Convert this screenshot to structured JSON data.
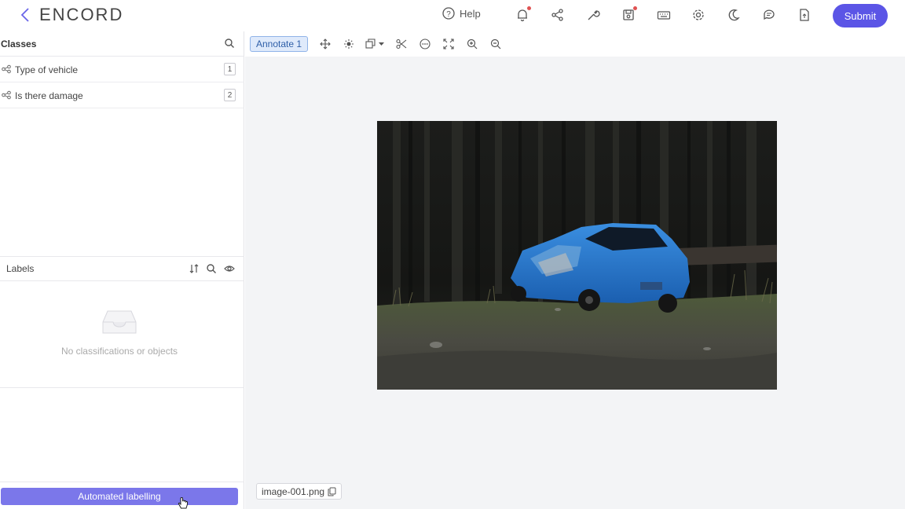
{
  "header": {
    "logo": "ENCORD",
    "help_label": "Help",
    "submit_label": "Submit",
    "accent": "#5b55e6"
  },
  "classes": {
    "title": "Classes",
    "items": [
      {
        "label": "Type of vehicle",
        "key": "1"
      },
      {
        "label": "Is there damage",
        "key": "2"
      }
    ]
  },
  "labels": {
    "title": "Labels",
    "empty_text": "No classifications or objects"
  },
  "automated_labelling_label": "Automated labelling",
  "toolbar": {
    "annotate_label": "Annotate 1"
  },
  "file": {
    "name": "image-001.png"
  },
  "icons": [
    "back-icon",
    "help-icon",
    "bell-icon",
    "share-icon",
    "wrench-icon",
    "save-icon",
    "keyboard-icon",
    "gear-icon",
    "moon-icon",
    "chat-icon",
    "document-icon",
    "search-icon",
    "sort-icon",
    "eye-icon",
    "move-icon",
    "brightness-icon",
    "shape-icon",
    "scissors-icon",
    "more-icon",
    "fit-screen-icon",
    "zoom-in-icon",
    "zoom-out-icon",
    "copy-icon",
    "inbox-icon",
    "hand-cursor-icon"
  ]
}
